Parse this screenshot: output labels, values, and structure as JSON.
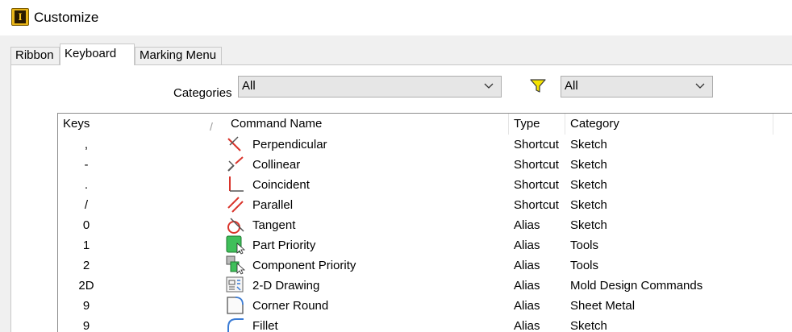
{
  "window": {
    "title": "Customize",
    "app_icon_letter": "I"
  },
  "tabs": [
    {
      "label": "Ribbon"
    },
    {
      "label": "Keyboard"
    },
    {
      "label": "Marking Menu"
    }
  ],
  "filters": {
    "categories_label": "Categories",
    "categories_value": "All",
    "type_filter_value": "All"
  },
  "table": {
    "headers": {
      "keys": "Keys",
      "sort_mark": "/",
      "command": "Command Name",
      "type": "Type",
      "category": "Category"
    },
    "rows": [
      {
        "key": ",",
        "icon": "perpendicular-icon",
        "command": "Perpendicular",
        "type": "Shortcut",
        "category": "Sketch"
      },
      {
        "key": "-",
        "icon": "collinear-icon",
        "command": "Collinear",
        "type": "Shortcut",
        "category": "Sketch"
      },
      {
        "key": ".",
        "icon": "coincident-icon",
        "command": "Coincident",
        "type": "Shortcut",
        "category": "Sketch"
      },
      {
        "key": "/",
        "icon": "parallel-icon",
        "command": "Parallel",
        "type": "Shortcut",
        "category": "Sketch"
      },
      {
        "key": "0",
        "icon": "tangent-icon",
        "command": "Tangent",
        "type": "Alias",
        "category": "Sketch"
      },
      {
        "key": "1",
        "icon": "part-priority-icon",
        "command": "Part Priority",
        "type": "Alias",
        "category": "Tools"
      },
      {
        "key": "2",
        "icon": "component-priority-icon",
        "command": "Component Priority",
        "type": "Alias",
        "category": "Tools"
      },
      {
        "key": "2D",
        "icon": "drawing-2d-icon",
        "command": "2-D Drawing",
        "type": "Alias",
        "category": "Mold Design Commands"
      },
      {
        "key": "9",
        "icon": "corner-round-icon",
        "command": "Corner Round",
        "type": "Alias",
        "category": "Sheet Metal"
      },
      {
        "key": "9",
        "icon": "fillet-icon",
        "command": "Fillet",
        "type": "Alias",
        "category": "Sketch"
      }
    ]
  }
}
